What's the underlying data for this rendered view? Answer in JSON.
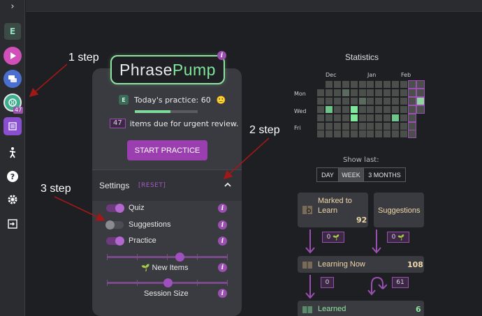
{
  "sidebar": {
    "expand_glyph": "›",
    "user_initial": "E",
    "badge": "47",
    "icons": [
      "play-icon",
      "chat-icon",
      "brain-icon",
      "list-icon",
      "exercise-icon",
      "help-icon",
      "gear-icon",
      "logout-icon"
    ]
  },
  "annotations": {
    "step1": "1 step",
    "step2": "2 step",
    "step3": "3 step",
    "arrow_color": "#a01818"
  },
  "app": {
    "logo_part1": "Phrase",
    "logo_part2": "Pump",
    "info": "i",
    "practice_initial": "E",
    "today_practice": "Today's practice: 60",
    "emoji": "🙂",
    "progress_fraction": 0.57,
    "due_count": "47",
    "due_text": "items due for urgent review.",
    "start_button": "START PRACTICE"
  },
  "settings": {
    "title": "Settings",
    "reset": "[RESET]",
    "chevron": "⌃",
    "toggles": [
      {
        "label": "Quiz",
        "on": true
      },
      {
        "label": "Suggestions",
        "on": false
      },
      {
        "label": "Practice",
        "on": true
      }
    ],
    "new_items_label": "New Items",
    "new_items_level": 0.6,
    "session_size_label": "Session Size",
    "session_size_level": 0.5
  },
  "statistics": {
    "title": "Statistics",
    "months": [
      "Dec",
      "Jan",
      "Feb"
    ],
    "days": [
      "Mon",
      "Wed",
      "Fri"
    ],
    "show_last": "Show last:",
    "ranges": [
      "DAY",
      "WEEK",
      "3 MONTHS"
    ],
    "selected_range": "WEEK",
    "marked_label": "Marked to\nLearn",
    "marked_count": "92",
    "suggestions_label": "Suggestions",
    "to_learning_badge": "0",
    "suggest_badge": "0",
    "learning_label": "Learning Now",
    "learning_count": "108",
    "to_learned_badge": "0",
    "relearn_badge": "61",
    "learned_label": "Learned",
    "learned_count": "6",
    "accent_green": "#7fe69b",
    "accent_purple": "#9b4fb0"
  }
}
